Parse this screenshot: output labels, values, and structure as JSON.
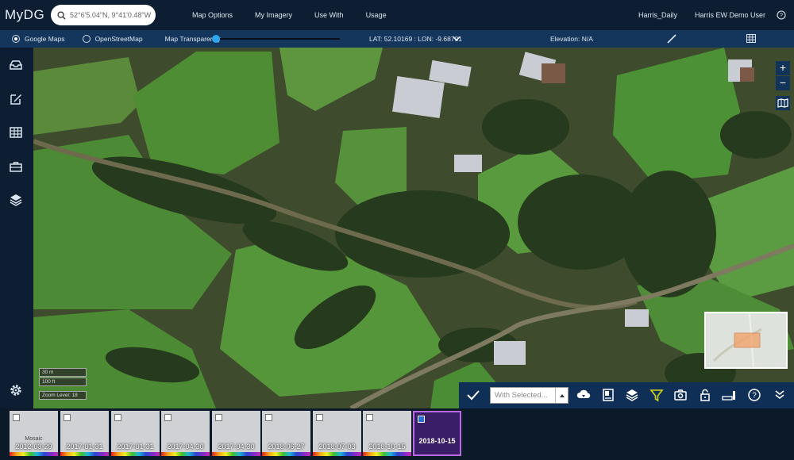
{
  "app": {
    "brand": "MyDG"
  },
  "search": {
    "value": "52°6'5.04\"N, 9°41'0.48\"W"
  },
  "nav": {
    "map_options": "Map Options",
    "my_imagery": "My Imagery",
    "use_with": "Use With",
    "usage": "Usage"
  },
  "user": {
    "account": "Harris_Daily",
    "name": "Harris EW Demo User"
  },
  "subbar": {
    "google_maps": "Google Maps",
    "openstreetmap": "OpenStreetMap",
    "transparency": "Map Transparency",
    "transparency_level": 0,
    "coords": "LAT: 52.10169 : LON: -9.68701",
    "elevation": "Elevation: N/A"
  },
  "map": {
    "zoom_in": "+",
    "zoom_out": "−",
    "scale_m": "30 m",
    "scale_ft": "100 ft",
    "zoom_level": "Zoom Level: 18"
  },
  "toolbar": {
    "with_selected": "With Selected..."
  },
  "thumbnails": [
    {
      "date": "2012-03-29",
      "label": "Mosaic",
      "checked": false
    },
    {
      "date": "2017-01-31",
      "checked": false
    },
    {
      "date": "2017-01-31",
      "checked": false
    },
    {
      "date": "2017-04-30",
      "checked": false
    },
    {
      "date": "2017-04-30",
      "checked": false
    },
    {
      "date": "2018-06-27",
      "checked": false
    },
    {
      "date": "2018-07-03",
      "checked": false
    },
    {
      "date": "2018-10-15",
      "checked": false
    },
    {
      "date": "2018-10-15",
      "checked": true
    }
  ],
  "colors": {
    "topbar": "#0d1e33",
    "subbar": "#14365c",
    "accent": "#2ea6f2",
    "filter": "#d4d81e",
    "selected_thumb": "#3a1f68"
  },
  "icons": [
    "search-icon",
    "chevron-down-icon",
    "ruler-icon",
    "grid-icon",
    "inbox-icon",
    "edit-icon",
    "table-icon",
    "briefcase-icon",
    "layers-icon",
    "gear-icon",
    "help-icon",
    "map-book-icon",
    "check-icon",
    "cloud-download-icon",
    "image-report-icon",
    "filter-icon",
    "camera-icon",
    "lock-icon",
    "signal-bars-icon"
  ]
}
